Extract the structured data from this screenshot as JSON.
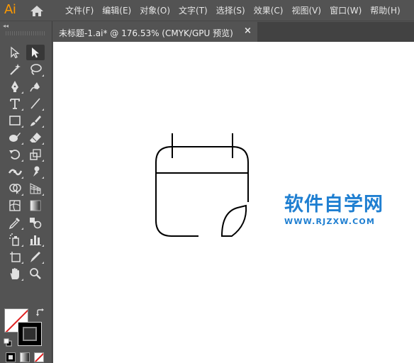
{
  "app": {
    "logo": "Ai"
  },
  "menu": {
    "items": [
      "文件(F)",
      "编辑(E)",
      "对象(O)",
      "文字(T)",
      "选择(S)",
      "效果(C)",
      "视图(V)",
      "窗口(W)",
      "帮助(H)"
    ]
  },
  "toolbar": {
    "collapse": "◂◂",
    "tools": [
      "selection-tool",
      "direct-selection-tool",
      "magic-wand-tool",
      "lasso-tool",
      "pen-tool",
      "curvature-tool",
      "type-tool",
      "line-segment-tool",
      "rectangle-tool",
      "paintbrush-tool",
      "blob-brush-tool",
      "eraser-tool",
      "rotate-tool",
      "scale-tool",
      "width-tool",
      "puppet-warp-tool",
      "shape-builder-tool",
      "perspective-grid-tool",
      "mesh-tool",
      "gradient-tool",
      "eyedropper-tool",
      "blend-tool",
      "symbol-sprayer-tool",
      "column-graph-tool",
      "artboard-tool",
      "slice-tool",
      "hand-tool",
      "zoom-tool"
    ],
    "active_tool": "direct-selection-tool",
    "fill": "none",
    "stroke": "#000000"
  },
  "document": {
    "tab_label": "未标题-1.ai* @ 176.53% (CMYK/GPU 预览)",
    "close": "×"
  },
  "watermark": {
    "title": "软件自学网",
    "url": "WWW.RJZXW.COM"
  },
  "colors": {
    "chrome": "#535353",
    "accent_logo": "#ff9a00",
    "watermark": "#1f7fd1",
    "canvas": "#ffffff"
  }
}
